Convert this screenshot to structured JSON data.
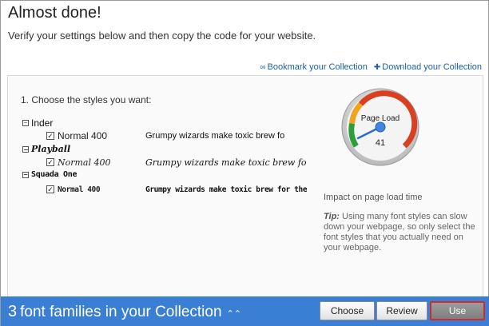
{
  "header": {
    "title": "Almost done!",
    "subtitle": "Verify your settings below and then copy the code for your website."
  },
  "links": {
    "bookmark": "Bookmark your Collection",
    "download": "Download your Collection",
    "bookmark_icon": "link-icon",
    "download_icon": "plus-icon"
  },
  "panel": {
    "choose_label": "1. Choose the styles you want:",
    "families": [
      {
        "name": "Inder",
        "style": "Normal 400",
        "checked": true,
        "sample": "Grumpy wizards make toxic brew fo"
      },
      {
        "name": "Playball",
        "style": "Normal 400",
        "checked": true,
        "sample": "Grumpy wizards make toxic brew for the evil"
      },
      {
        "name": "Squada One",
        "style": "Normal 400",
        "checked": true,
        "sample": "Grumpy wizards make toxic brew for the evil Q"
      }
    ],
    "gauge": {
      "label": "Page Load",
      "value": "41",
      "colors": [
        "#2e9e3a",
        "#f2a31b",
        "#d94021"
      ]
    },
    "impact": "Impact on page load time",
    "tip_label": "Tip:",
    "tip_text": " Using many font styles can slow down your webpage, so only select the font styles that you actually need on your webpage."
  },
  "bottombar": {
    "count": "3",
    "label": "font families in your Collection",
    "chevron_icon": "double-chevron-up-icon",
    "buttons": {
      "choose": "Choose",
      "review": "Review",
      "use": "Use"
    },
    "accent": "#3b7fd4"
  }
}
